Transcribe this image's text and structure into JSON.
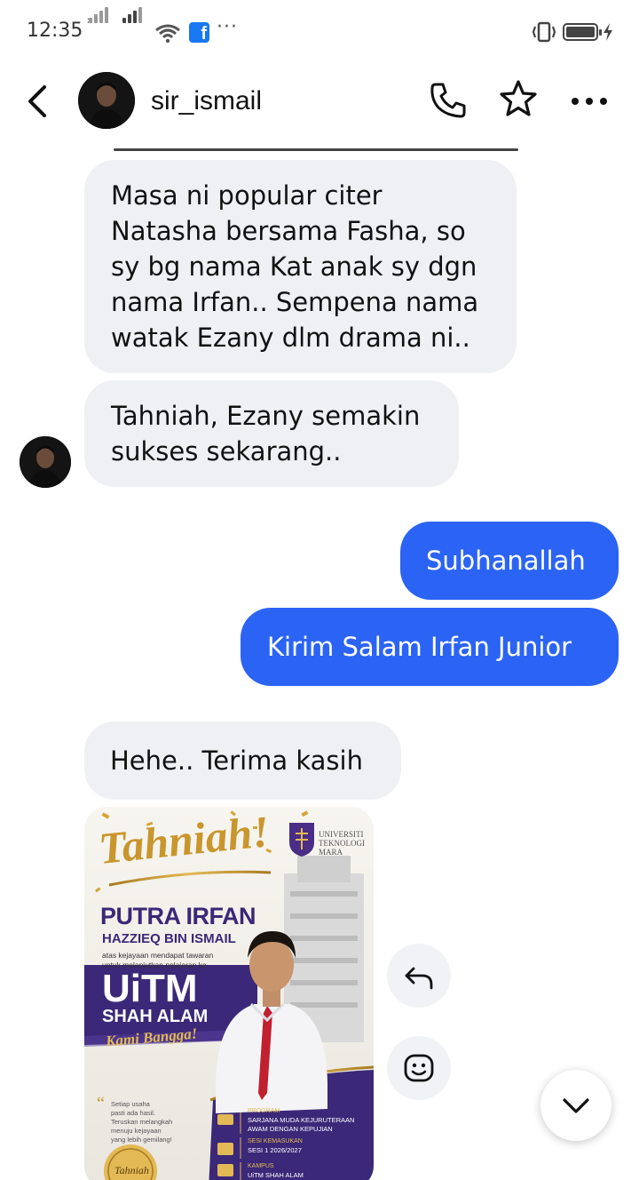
{
  "status_bar": {
    "time": "12:35",
    "more": "···"
  },
  "header": {
    "username": "sir_ismail",
    "icons": [
      "back-arrow-icon",
      "phone-icon",
      "star-icon",
      "more-icon"
    ]
  },
  "messages": [
    {
      "direction": "in",
      "lines": [
        "Masa ni popular citer",
        "Natasha bersama Fasha, so",
        "sy bg nama Kat anak sy dgn",
        "nama Irfan.. Sempena nama",
        "watak Ezany dlm drama ni.."
      ]
    },
    {
      "direction": "in",
      "lines": [
        "Tahniah, Ezany semakin",
        "sukses sekarang.."
      ]
    },
    {
      "direction": "out",
      "lines": [
        "Subhanallah"
      ]
    },
    {
      "direction": "out",
      "lines": [
        "Kirim Salam Irfan Junior"
      ]
    },
    {
      "direction": "in",
      "lines": [
        "Hehe.. Terima kasih"
      ]
    }
  ],
  "photo_message": {
    "tahniah": "Tahniah!",
    "uni_name": [
      "UNIVERSITI",
      "TEKNOLOGI",
      "MARA"
    ],
    "name1": "PUTRA IRFAN",
    "name2": "HAZZIEQ BIN ISMAIL",
    "intro": [
      "atas kejayaan mendapat tawaran",
      "untuk melanjutkan pelajaran ke"
    ],
    "uitm": "UiTM",
    "campus": "SHAH ALAM",
    "kami_bangga": "Kami Bangga!",
    "quote": [
      "Setiap usaha",
      "pasti ada hasil.",
      "Teruskan melangkah",
      "menuju kejayaan",
      "yang lebih gemilang!"
    ],
    "seal": "Tahniah",
    "program_label": "PROGRAM",
    "program_value": [
      "SARJANA MUDA KEJURUTERAAN",
      "AWAM DENGAN KEPUJIAN"
    ],
    "session_label": "SESI KEMASUKAN",
    "session_value": "SESI 1 2026/2027",
    "campus_label": "KAMPUS",
    "campus_value": "UiTM SHAH ALAM"
  },
  "colors": {
    "outgoing_bubble": "#2b64f5",
    "incoming_bubble": "#eff0f4",
    "poster_purple": "#3b2878",
    "poster_gold": "#c9962e"
  }
}
